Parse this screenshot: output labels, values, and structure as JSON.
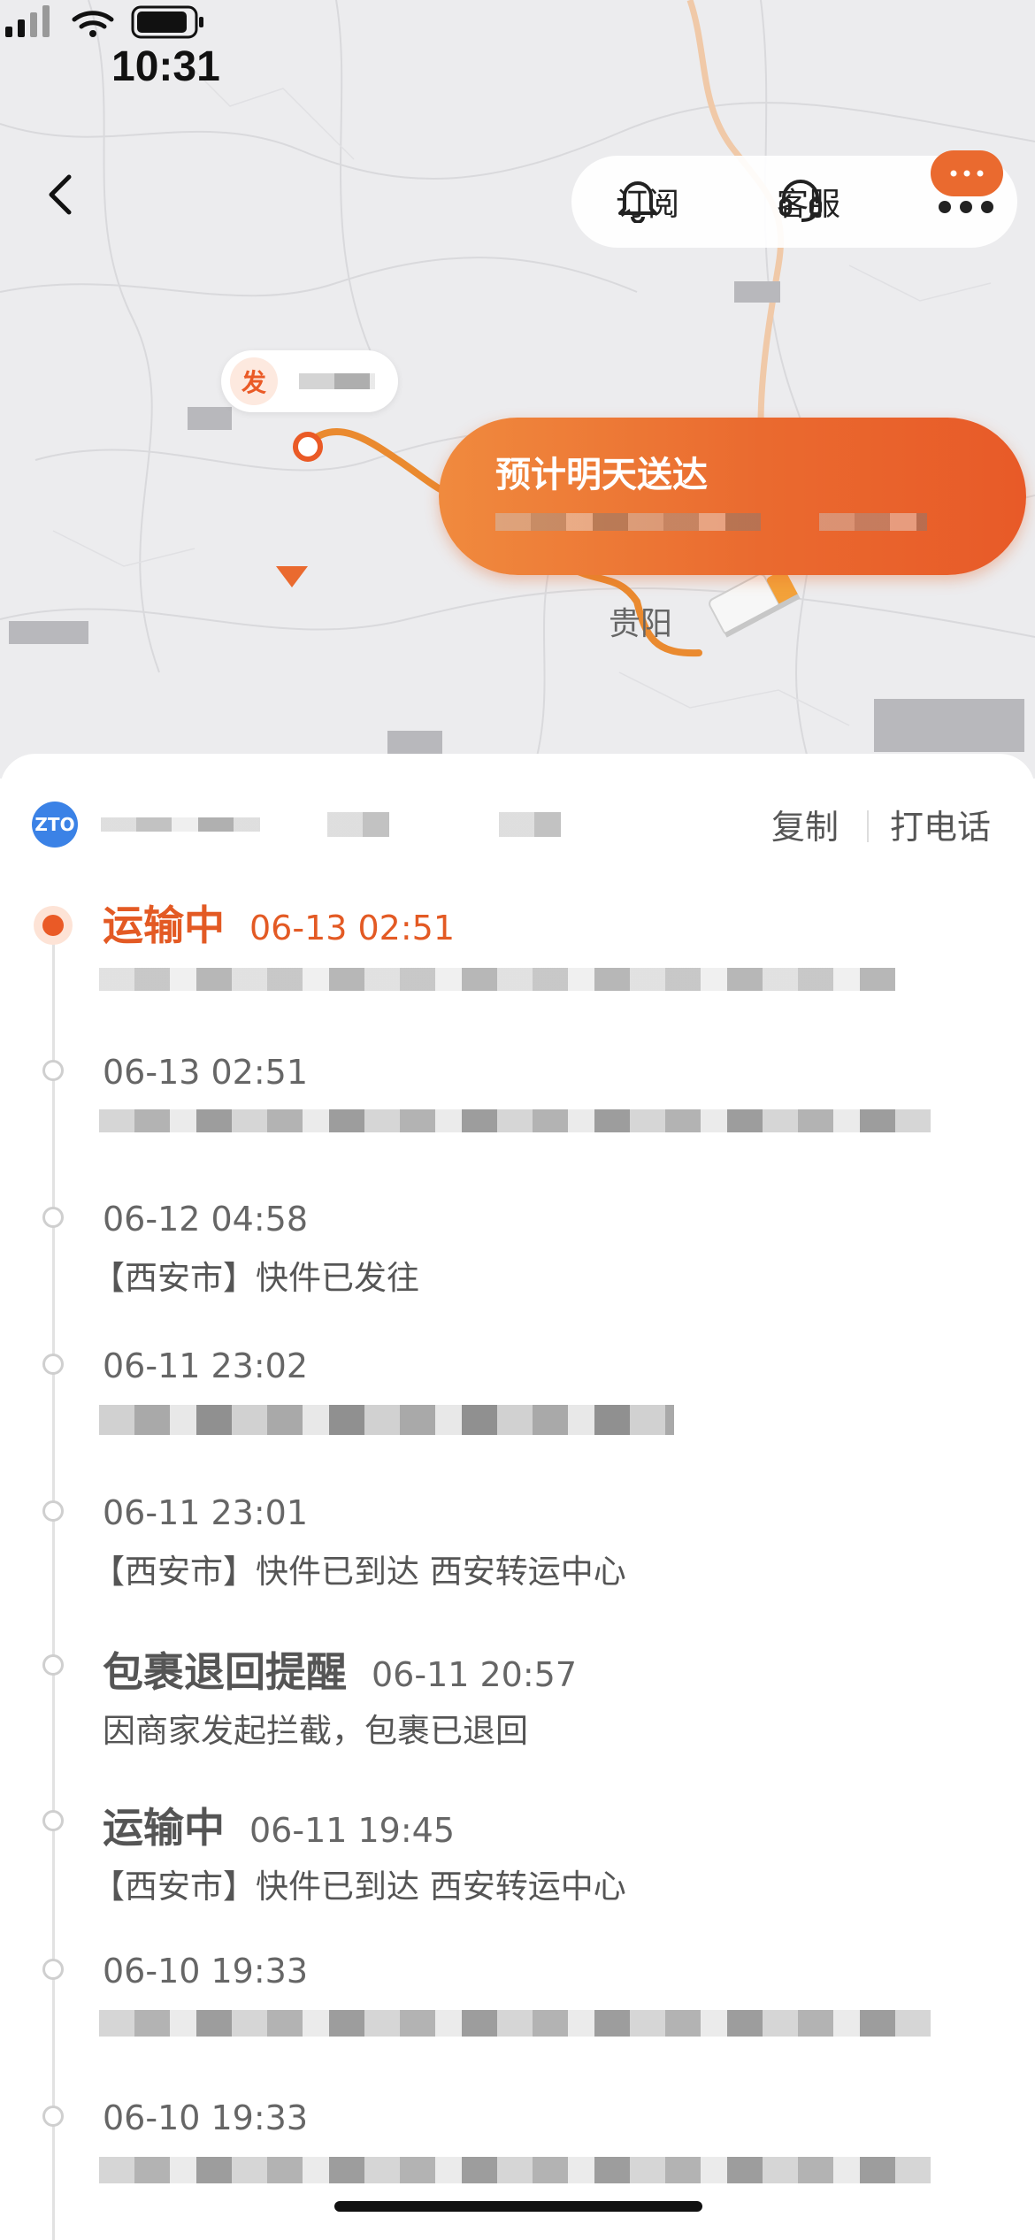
{
  "status_bar": {
    "time": "10:31"
  },
  "header": {
    "subscribe_label": "订阅",
    "service_label": "客服"
  },
  "map": {
    "origin_badge": "发",
    "eta_title": "预计明天送达",
    "city_label": "贵阳",
    "colors": {
      "route": "#ea8a2f",
      "accent": "#ea5a26"
    }
  },
  "carrier": {
    "logo_text": "ZTO",
    "copy_label": "复制",
    "call_label": "打电话"
  },
  "events": [
    {
      "status": "运输中",
      "time": "06-13 02:51",
      "desc": "",
      "active": true
    },
    {
      "status": "",
      "time": "06-13 02:51",
      "desc": ""
    },
    {
      "status": "",
      "time": "06-12 04:58",
      "desc": "【西安市】快件已发往"
    },
    {
      "status": "",
      "time": "06-11 23:02",
      "desc": ""
    },
    {
      "status": "",
      "time": "06-11 23:01",
      "desc": "【西安市】快件已到达 西安转运中心"
    },
    {
      "status": "包裹退回提醒",
      "time": "06-11 20:57",
      "desc": "因商家发起拦截，包裹已退回"
    },
    {
      "status": "运输中",
      "time": "06-11 19:45",
      "desc": "【西安市】快件已到达 西安转运中心"
    },
    {
      "status": "",
      "time": "06-10 19:33",
      "desc": ""
    },
    {
      "status": "",
      "time": "06-10 19:33",
      "desc": ""
    }
  ]
}
